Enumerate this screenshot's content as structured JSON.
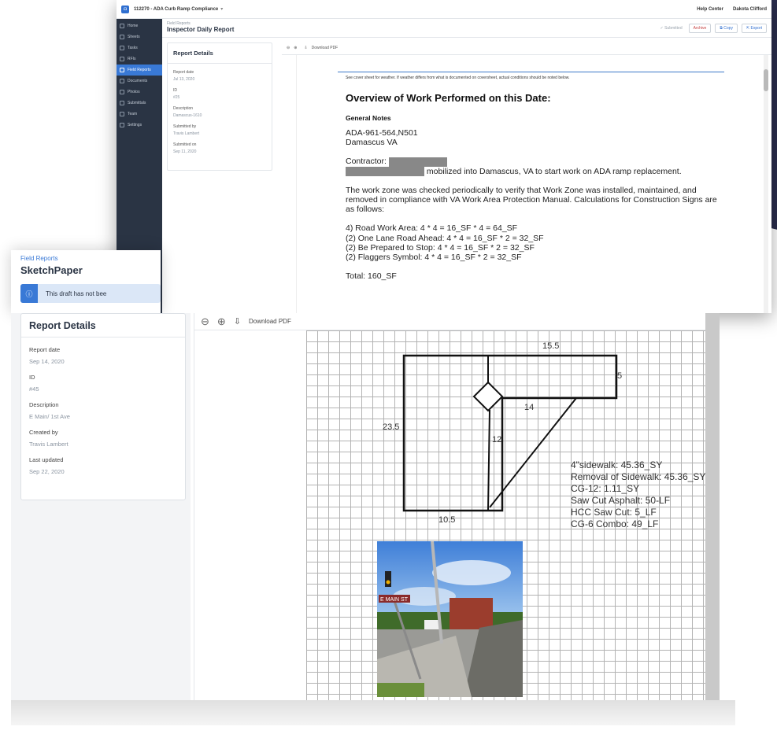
{
  "window_a": {
    "project": "112270 - ADA Curb Ramp Compliance",
    "help_center": "Help Center",
    "user_name": "Dakota Clifford",
    "sidebar": [
      "Home",
      "Sheets",
      "Tasks",
      "RFIs",
      "Field Reports",
      "Documents",
      "Photos",
      "Submittals",
      "Team",
      "Settings"
    ],
    "breadcrumb": "Field Reports",
    "title": "Inspector Daily Report",
    "status": "Submitted",
    "archive": "Archive",
    "copy": "Copy",
    "export": "Export",
    "details_title": "Report Details",
    "fields": [
      {
        "label": "Report date",
        "value": "Jul 13, 2020"
      },
      {
        "label": "ID",
        "value": "#25"
      },
      {
        "label": "Description",
        "value": "Damascus-1610"
      },
      {
        "label": "Submitted by",
        "value": "Travis Lambert"
      },
      {
        "label": "Submitted on",
        "value": "Sep 11, 2020"
      }
    ],
    "download_pdf": "Download PDF",
    "doc": {
      "weather_note": "See cover sheet for weather. If weather differs from what is documented on coversheet, actual conditions should be noted below.",
      "heading": "Overview of Work Performed on this Date:",
      "subheading": "General Notes",
      "line1": "ADA-961-564,N501",
      "line2": "Damascus VA",
      "contractor_label": "Contractor:",
      "mobilized": "mobilized into Damascus, VA to start work on ADA ramp replacement.",
      "workzone": "The work zone was checked periodically to verify that Work Zone was installed, maintained, and removed in compliance with VA Work Area Protection Manual. Calculations for Construction Signs are as follows:",
      "sign1": "4) Road Work Area: 4 * 4 = 16_SF * 4 = 64_SF",
      "sign2": "(2) One Lane Road Ahead: 4 * 4 = 16_SF * 2 = 32_SF",
      "sign3": "(2) Be Prepared to Stop: 4 * 4 = 16_SF * 2 = 32_SF",
      "sign4": "(2) Flaggers Symbol: 4 * 4 = 16_SF * 2 = 32_SF",
      "total": "Total: 160_SF"
    }
  },
  "window_b": {
    "breadcrumb": "Field Reports",
    "title": "SketchPaper",
    "notice": "This draft has not bee",
    "details_title": "Report Details",
    "fields": [
      {
        "label": "Report date",
        "value": "Sep 14, 2020"
      },
      {
        "label": "ID",
        "value": "#45"
      },
      {
        "label": "Description",
        "value": "E Main/ 1st Ave"
      },
      {
        "label": "Created by",
        "value": "Travis Lambert"
      },
      {
        "label": "Last updated",
        "value": "Sep 22, 2020"
      }
    ],
    "download_pdf": "Download PDF",
    "sketch": {
      "dims": [
        "15.5",
        "5",
        "14",
        "23.5",
        "12",
        "10.5"
      ],
      "quantities": [
        "4\"sidewalk: 45.36_SY",
        "Removal of Sidewalk: 45.36_SY",
        "CG-12: 1.11_SY",
        "Saw Cut Asphalt: 50-LF",
        "HCC Saw Cut: 5_LF",
        "CG-6 Combo: 49_LF"
      ]
    },
    "photo_sign_text": "E MAIN ST"
  }
}
